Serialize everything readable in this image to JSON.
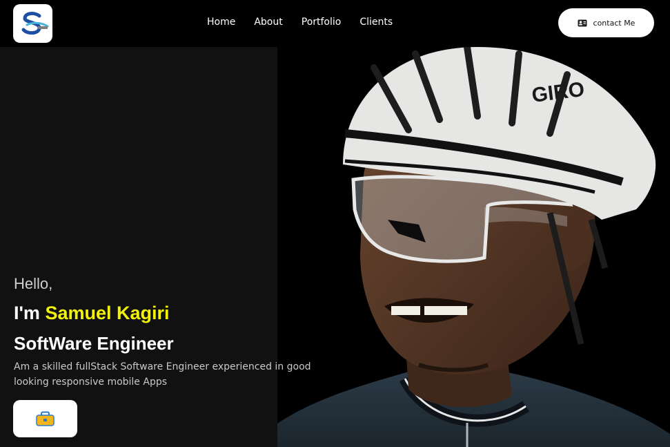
{
  "header": {
    "logo_icon": "s-monogram-logo-icon",
    "nav": [
      "Home",
      "About",
      "Portfolio",
      "Clients"
    ],
    "contact_label": "contact Me",
    "contact_icon": "contact-card-icon"
  },
  "hero": {
    "greeting": "Hello,",
    "intro_prefix": "I'm ",
    "name": "Samuel Kagiri",
    "role": "SoftWare Engineer",
    "description": "Am a skilled fullStack Software Engineer experienced in good looking responsive mobile Apps",
    "cta_icon": "briefcase-icon",
    "name_color": "#f2f20a"
  },
  "photo": {
    "helmet_text": "GIRO"
  }
}
